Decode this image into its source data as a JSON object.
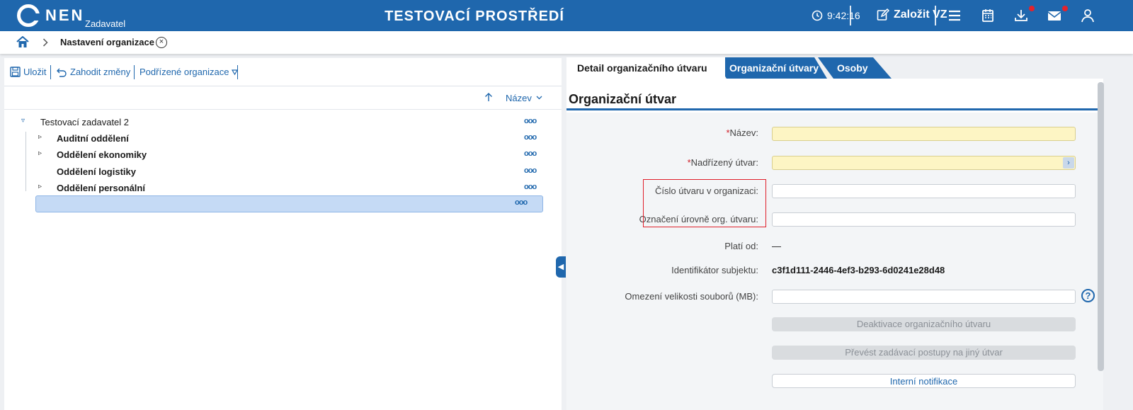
{
  "header": {
    "brand": "NEN",
    "brand_sub": "Zadavatel",
    "env_title": "TESTOVACÍ PROSTŘEDÍ",
    "clock": "9:42:16",
    "create_label": "Založit VZ",
    "colors": {
      "bar": "#1f67ad",
      "notification_dot": "#e3232d"
    }
  },
  "breadcrumb": {
    "current": "Nastavení organizace",
    "close_symbol": "×"
  },
  "toolbar": {
    "save_label": "Uložit",
    "discard_label": "Zahodit změny",
    "subordinate_label": "Podřízené organizace"
  },
  "sort": {
    "label": "Název"
  },
  "tree": {
    "root": "Testovací zadavatel 2",
    "more_symbol": "ooo",
    "items": [
      {
        "label": "Auditní oddělení",
        "expandable": true
      },
      {
        "label": "Oddělení ekonomiky",
        "expandable": true
      },
      {
        "label": "Oddělení logistiky",
        "expandable": false
      },
      {
        "label": "Oddělení personální",
        "expandable": true
      },
      {
        "label": "",
        "expandable": false,
        "selected": true
      }
    ]
  },
  "tabs": [
    {
      "label": "Detail organizačního útvaru",
      "active": true
    },
    {
      "label": "Organizační útvary",
      "active": false
    },
    {
      "label": "Osoby",
      "active": false
    }
  ],
  "form": {
    "section_title": "Organizační útvar",
    "fields": {
      "name": {
        "label": "Název:",
        "required": true,
        "value": ""
      },
      "parent": {
        "label": "Nadřízený útvar:",
        "required": true,
        "value": ""
      },
      "number": {
        "label": "Číslo útvaru v organizaci:",
        "value": ""
      },
      "level": {
        "label": "Označení úrovně org. útvaru:",
        "value": ""
      },
      "valid_from": {
        "label": "Platí od:",
        "value": "—"
      },
      "subject_id": {
        "label": "Identifikátor subjektu:",
        "value": "c3f1d111-2446-4ef3-b293-6d0241e28d48"
      },
      "file_limit": {
        "label": "Omezení velikosti souborů (MB):",
        "value": ""
      }
    },
    "required_mark": "*",
    "buttons": {
      "deactivate": "Deaktivace organizačního útvaru",
      "transfer": "Převést zadávací postupy na jiný útvar",
      "notifications": "Interní notifikace"
    },
    "help_symbol": "?"
  }
}
